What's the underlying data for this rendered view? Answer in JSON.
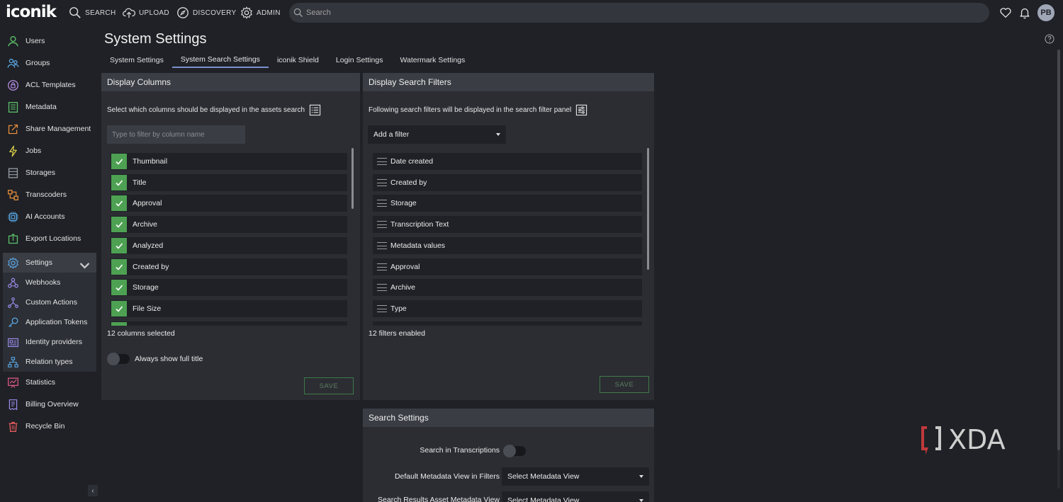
{
  "app": {
    "logo": "iconik"
  },
  "topnav": {
    "items": [
      {
        "label": "SEARCH",
        "icon": "search-icon"
      },
      {
        "label": "UPLOAD",
        "icon": "cloud-upload-icon"
      },
      {
        "label": "DISCOVERY",
        "icon": "compass-icon"
      },
      {
        "label": "ADMIN",
        "icon": "gear-icon"
      }
    ],
    "search_placeholder": "Search",
    "avatar_initials": "PB"
  },
  "sidebar": {
    "items": [
      {
        "label": "Users",
        "icon": "user-icon"
      },
      {
        "label": "Groups",
        "icon": "group-icon"
      },
      {
        "label": "ACL Templates",
        "icon": "acl-template-icon"
      },
      {
        "label": "Metadata",
        "icon": "metadata-icon"
      },
      {
        "label": "Share Management",
        "icon": "share-icon"
      },
      {
        "label": "Jobs",
        "icon": "lightning-icon"
      },
      {
        "label": "Storages",
        "icon": "storage-icon"
      },
      {
        "label": "Transcoders",
        "icon": "transcoder-icon"
      },
      {
        "label": "AI Accounts",
        "icon": "chip-icon"
      },
      {
        "label": "Export Locations",
        "icon": "export-icon"
      },
      {
        "label": "Settings",
        "icon": "settings-gear-icon"
      }
    ],
    "settings_children": [
      {
        "label": "Webhooks",
        "icon": "webhook-icon"
      },
      {
        "label": "Custom Actions",
        "icon": "custom-actions-icon"
      },
      {
        "label": "Application Tokens",
        "icon": "key-icon"
      },
      {
        "label": "Identity providers",
        "icon": "identity-icon"
      },
      {
        "label": "Relation types",
        "icon": "relation-icon"
      }
    ],
    "bottom_items": [
      {
        "label": "Statistics",
        "icon": "statistics-icon"
      },
      {
        "label": "Billing Overview",
        "icon": "billing-icon"
      },
      {
        "label": "Recycle Bin",
        "icon": "trash-icon"
      }
    ],
    "collapse_glyph": "‹"
  },
  "page": {
    "title": "System Settings",
    "tabs": [
      {
        "label": "System Settings",
        "active": false
      },
      {
        "label": "System Search Settings",
        "active": true
      },
      {
        "label": "iconik Shield",
        "active": false
      },
      {
        "label": "Login Settings",
        "active": false
      },
      {
        "label": "Watermark Settings",
        "active": false
      }
    ]
  },
  "display_columns": {
    "title": "Display Columns",
    "description": "Select which columns should be displayed in the assets search",
    "filter_placeholder": "Type to filter by column name",
    "columns": [
      "Thumbnail",
      "Title",
      "Approval",
      "Archive",
      "Analyzed",
      "Created by",
      "Storage",
      "File Size"
    ],
    "count_text": "12 columns selected",
    "toggle_label": "Always show full title",
    "save_label": "SAVE"
  },
  "display_filters": {
    "title": "Display Search Filters",
    "description": "Following search filters will be displayed in the search filter panel",
    "add_filter_label": "Add a filter",
    "filters": [
      "Date created",
      "Created by",
      "Storage",
      "Transcription Text",
      "Metadata values",
      "Approval",
      "Archive",
      "Type"
    ],
    "count_text": "12 filters enabled",
    "save_label": "SAVE"
  },
  "search_settings": {
    "title": "Search Settings",
    "transcriptions_label": "Search in Transcriptions",
    "default_view_label": "Default Metadata View in Filters",
    "default_view_value": "Select Metadata View",
    "results_view_label": "Search Results Asset Metadata View",
    "results_view_value": "Select Metadata View"
  },
  "watermark": {
    "text": "XDA"
  },
  "colors": {
    "background": "#1f2126",
    "panel": "#2b2d33",
    "panel_header": "#3a3d44",
    "check_green": "#4ea153",
    "tab_underline": "#7b8fcf"
  }
}
